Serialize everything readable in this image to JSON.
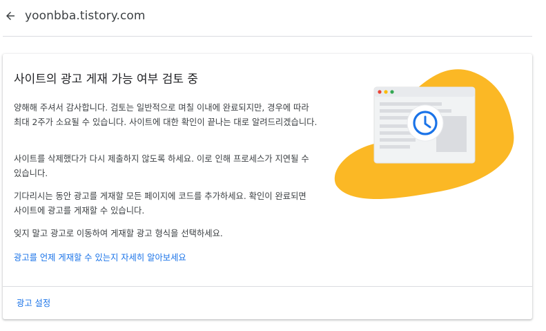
{
  "header": {
    "back_icon": "arrow-back-icon",
    "site": "yoonbba.tistory.com"
  },
  "card": {
    "title": "사이트의 광고 게재 가능 여부 검토 중",
    "paragraphs": [
      "양해해 주셔서 감사합니다. 검토는 일반적으로 며칠 이내에 완료되지만, 경우에 따라 최대 2주가 소요될 수 있습니다. 사이트에 대한 확인이 끝나는 대로 알려드리겠습니다.",
      "사이트를 삭제했다가 다시 제출하지 않도록 하세요. 이로 인해 프로세스가 지연될 수 있습니다.",
      "기다리시는 동안 광고를 게재할 모든 페이지에 코드를 추가하세요. 확인이 완료되면 사이트에 광고를 게재할 수 있습니다.",
      "잊지 말고 광고로 이동하여 게재할 광고 형식을 선택하세요."
    ],
    "learn_more_link": "광고를 언제 게재할 수 있는지 자세히 알아보세요",
    "footer_button": "광고 설정"
  },
  "illustration": {
    "icon": "clock-review-icon",
    "colors": {
      "blob": "#fbb825",
      "clock": "#1a73e8",
      "dot_red": "#ea4335",
      "dot_yellow": "#fbbc04",
      "dot_green": "#34a853"
    }
  }
}
